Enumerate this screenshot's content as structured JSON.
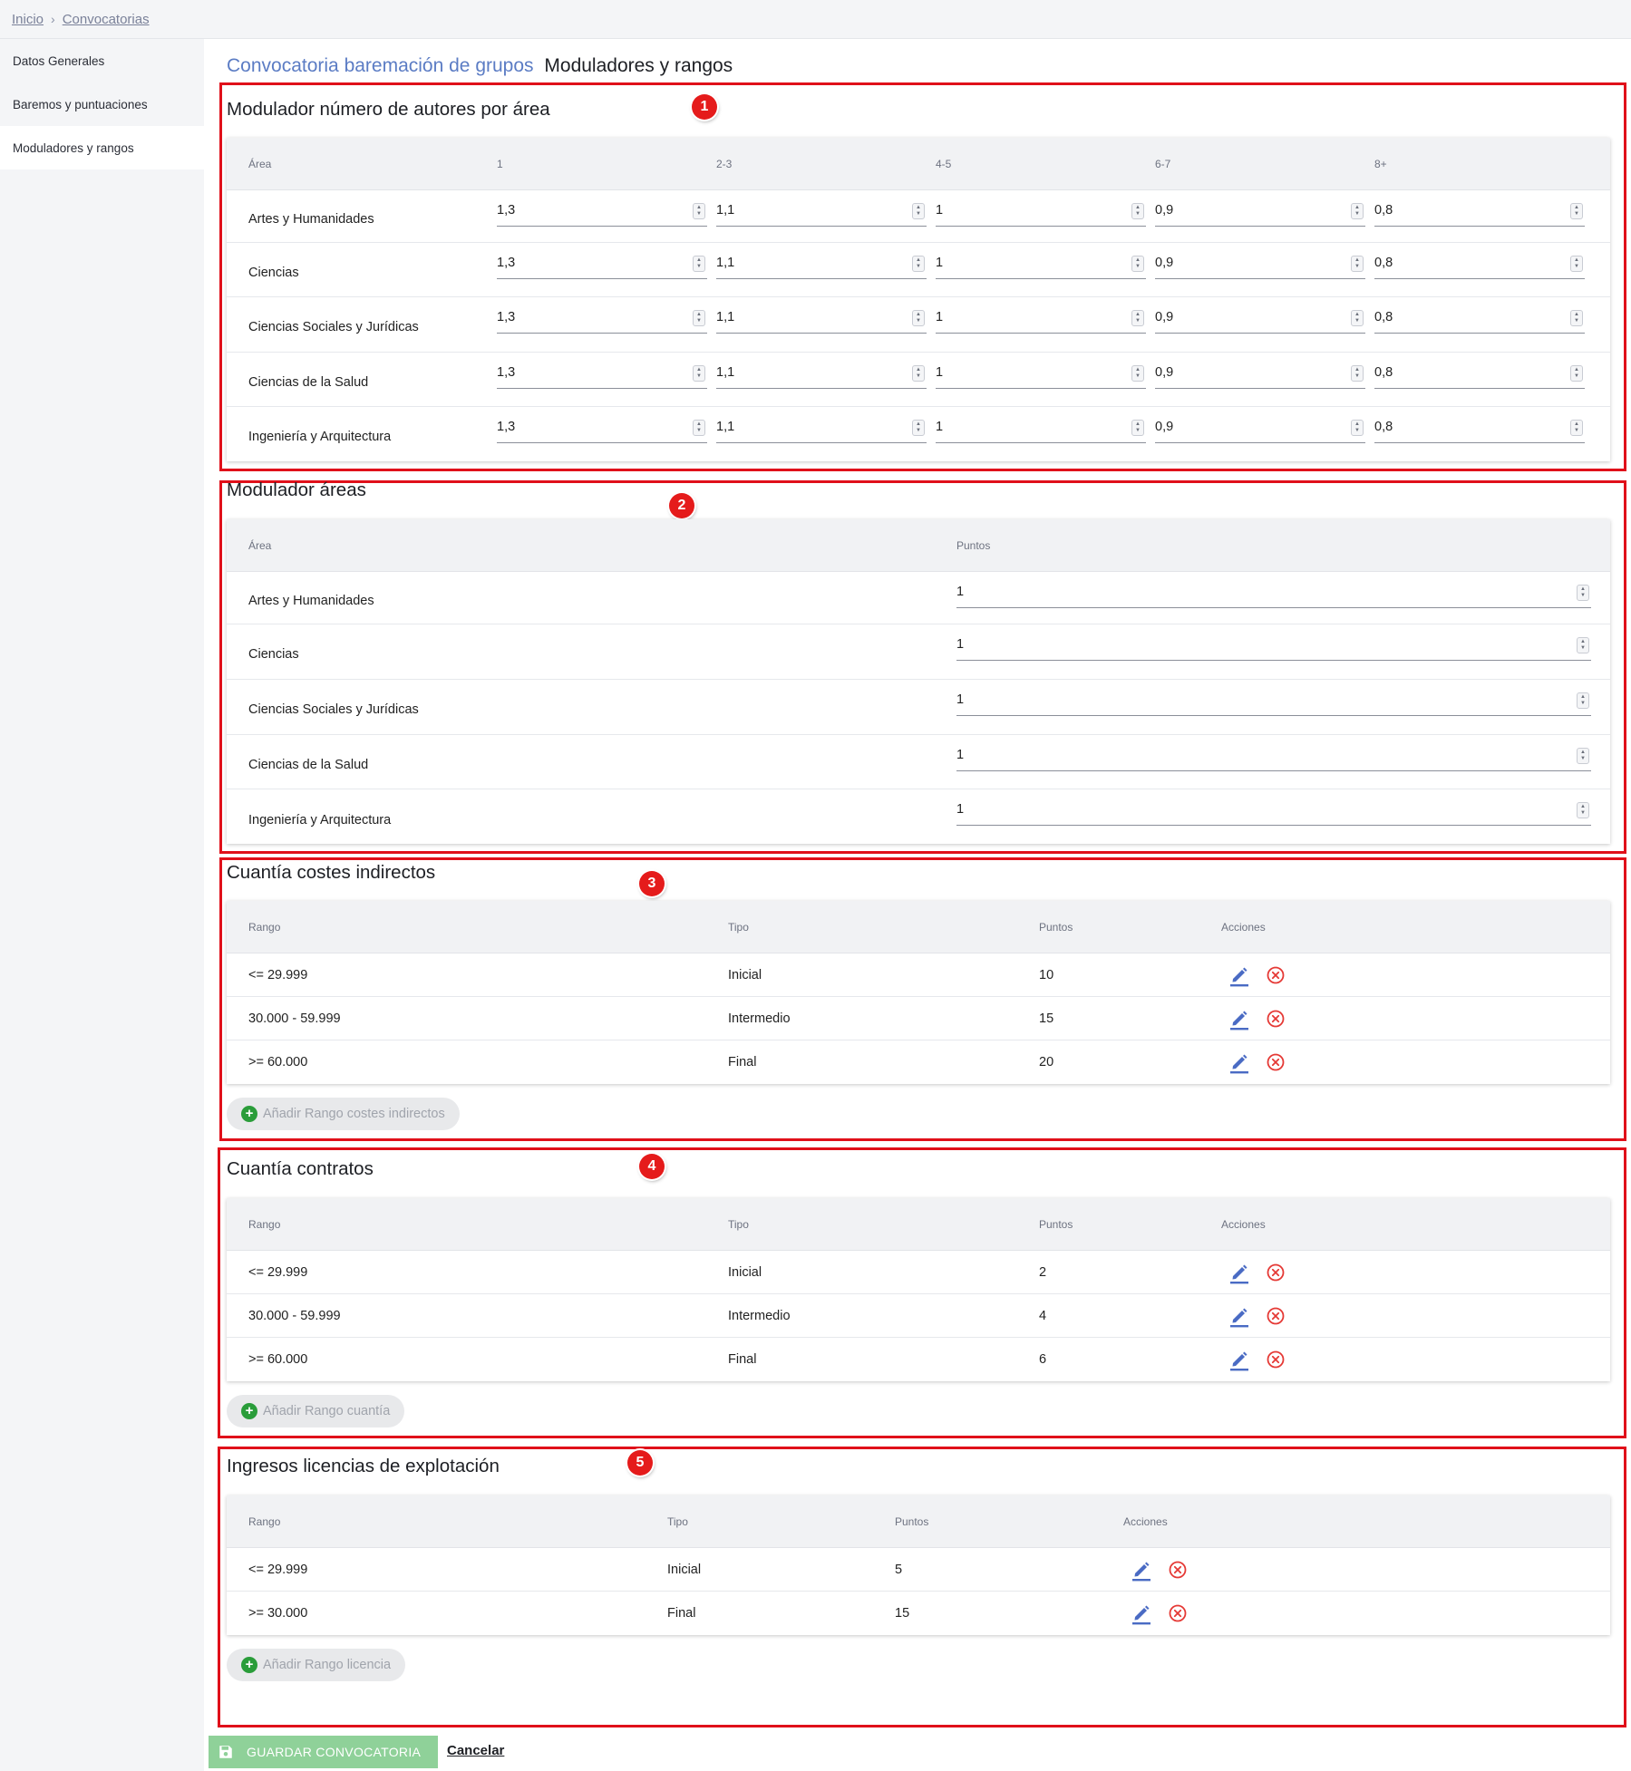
{
  "breadcrumb": {
    "home": "Inicio",
    "separator": "›",
    "current": "Convocatorias"
  },
  "sidebar": {
    "items": [
      {
        "label": "Datos Generales"
      },
      {
        "label": "Baremos y puntuaciones"
      },
      {
        "label": "Moduladores y rangos",
        "active": true
      }
    ]
  },
  "page": {
    "title_link": "Convocatoria baremación de grupos",
    "title_current": "Moduladores y rangos"
  },
  "markers": [
    "1",
    "2",
    "3",
    "4",
    "5"
  ],
  "section1": {
    "title": "Modulador número de autores por área",
    "headers": [
      "Área",
      "1",
      "2-3",
      "4-5",
      "6-7",
      "8+"
    ],
    "rows": [
      {
        "area": "Artes y Humanidades",
        "values": [
          "1,3",
          "1,1",
          "1",
          "0,9",
          "0,8"
        ]
      },
      {
        "area": "Ciencias",
        "values": [
          "1,3",
          "1,1",
          "1",
          "0,9",
          "0,8"
        ]
      },
      {
        "area": "Ciencias Sociales y Jurídicas",
        "values": [
          "1,3",
          "1,1",
          "1",
          "0,9",
          "0,8"
        ]
      },
      {
        "area": "Ciencias de la Salud",
        "values": [
          "1,3",
          "1,1",
          "1",
          "0,9",
          "0,8"
        ]
      },
      {
        "area": "Ingeniería y Arquitectura",
        "values": [
          "1,3",
          "1,1",
          "1",
          "0,9",
          "0,8"
        ]
      }
    ]
  },
  "section2": {
    "title": "Modulador áreas",
    "headers": [
      "Área",
      "Puntos"
    ],
    "rows": [
      {
        "area": "Artes y Humanidades",
        "value": "1"
      },
      {
        "area": "Ciencias",
        "value": "1"
      },
      {
        "area": "Ciencias Sociales y Jurídicas",
        "value": "1"
      },
      {
        "area": "Ciencias de la Salud",
        "value": "1"
      },
      {
        "area": "Ingeniería y Arquitectura",
        "value": "1"
      }
    ]
  },
  "section3": {
    "title": "Cuantía costes indirectos",
    "headers": [
      "Rango",
      "Tipo",
      "Puntos",
      "Acciones"
    ],
    "rows": [
      {
        "rango": "<= 29.999",
        "tipo": "Inicial",
        "puntos": "10"
      },
      {
        "rango": "30.000 - 59.999",
        "tipo": "Intermedio",
        "puntos": "15"
      },
      {
        "rango": ">= 60.000",
        "tipo": "Final",
        "puntos": "20"
      }
    ],
    "add_label": "Añadir Rango costes indirectos"
  },
  "section4": {
    "title": "Cuantía contratos",
    "headers": [
      "Rango",
      "Tipo",
      "Puntos",
      "Acciones"
    ],
    "rows": [
      {
        "rango": "<= 29.999",
        "tipo": "Inicial",
        "puntos": "2"
      },
      {
        "rango": "30.000 - 59.999",
        "tipo": "Intermedio",
        "puntos": "4"
      },
      {
        "rango": ">= 60.000",
        "tipo": "Final",
        "puntos": "6"
      }
    ],
    "add_label": "Añadir Rango cuantía"
  },
  "section5": {
    "title": "Ingresos licencias de explotación",
    "headers": [
      "Rango",
      "Tipo",
      "Puntos",
      "Acciones"
    ],
    "rows": [
      {
        "rango": "<= 29.999",
        "tipo": "Inicial",
        "puntos": "5"
      },
      {
        "rango": ">= 30.000",
        "tipo": "Final",
        "puntos": "15"
      }
    ],
    "add_label": "Añadir Rango licencia"
  },
  "footer": {
    "save_label": "GUARDAR CONVOCATORIA",
    "cancel_label": "Cancelar"
  },
  "colors": {
    "accent_link": "#5b7cc4",
    "annotation_red": "#e0101a",
    "save_green": "#8fd199",
    "edit_blue": "#4a6bc4",
    "delete_red": "#e53935",
    "add_green": "#2a9d3a"
  },
  "icons": {
    "edit": "pencil-icon",
    "delete": "close-circle-icon",
    "add": "plus-circle-icon",
    "save": "floppy-disk-icon",
    "separator": "chevron-right-icon",
    "spinner": "chevron-up-down-icon"
  }
}
